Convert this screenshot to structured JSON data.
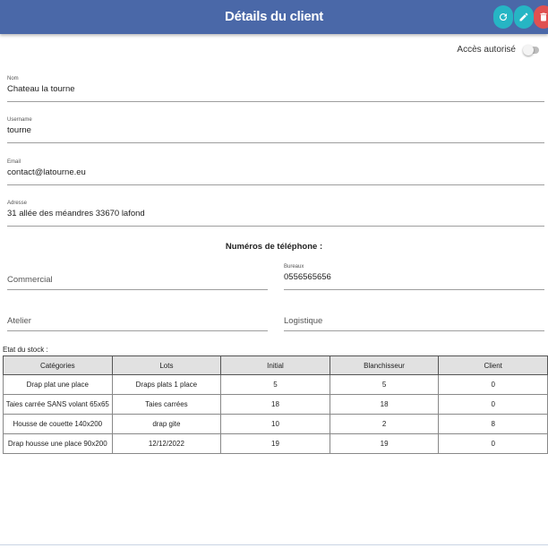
{
  "header": {
    "title": "Détails du client",
    "buttons": [
      {
        "name": "refresh",
        "icon": "refresh-icon",
        "color": "#26b5c4"
      },
      {
        "name": "edit",
        "icon": "pencil-icon",
        "color": "#26b5c4"
      },
      {
        "name": "delete",
        "icon": "trash-icon",
        "color": "#e05151"
      }
    ],
    "color": "#4a68a8"
  },
  "access": {
    "label": "Accès autorisé",
    "enabled": false
  },
  "fields": {
    "nom": {
      "label": "Nom",
      "value": "Chateau la tourne"
    },
    "username": {
      "label": "Username",
      "value": "tourne"
    },
    "email": {
      "label": "Email",
      "value": "contact@latourne.eu"
    },
    "adresse": {
      "label": "Adresse",
      "value": "31 allée des méandres 33670 lafond"
    }
  },
  "phones": {
    "title": "Numéros de téléphone :",
    "commercial": {
      "placeholder": "Commercial"
    },
    "bureaux": {
      "label": "Bureaux",
      "value": "0556565656"
    },
    "atelier": {
      "placeholder": "Atelier"
    },
    "logistique": {
      "placeholder": "Logistique"
    }
  },
  "stock": {
    "title": "Etat du stock :",
    "headers": [
      "Catégories",
      "Lots",
      "Initial",
      "Blanchisseur",
      "Client"
    ],
    "rows": [
      [
        "Drap plat une place",
        "Draps plats 1 place",
        "5",
        "5",
        "0"
      ],
      [
        "Taies carrée SANS volant 65x65",
        "Taies carrées",
        "18",
        "18",
        "0"
      ],
      [
        "Housse de couette 140x200",
        "drap gite",
        "10",
        "2",
        "8"
      ],
      [
        "Drap housse une place 90x200",
        "12/12/2022",
        "19",
        "19",
        "0"
      ]
    ]
  }
}
